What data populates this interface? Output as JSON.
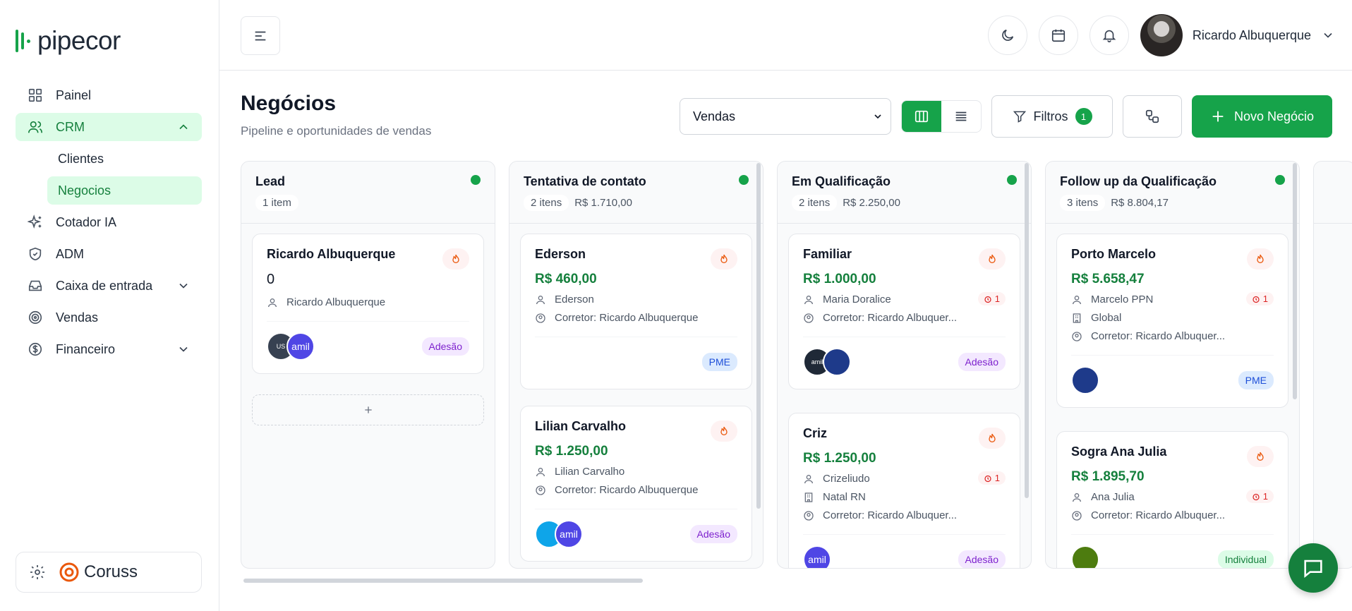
{
  "brand": {
    "name": "pipecor",
    "footer_brand": "Coruss"
  },
  "colors": {
    "accent": "#16a34a",
    "accent_light": "#dcfce7",
    "adesao": "#7e22ce",
    "pme": "#1d4ed8",
    "alert": "#dc2626"
  },
  "sidebar": {
    "items": [
      {
        "label": "Painel",
        "icon": "grid-icon"
      },
      {
        "label": "CRM",
        "icon": "users-icon"
      },
      {
        "label": "Clientes"
      },
      {
        "label": "Negocios"
      },
      {
        "label": "Cotador IA",
        "icon": "sparkles-icon"
      },
      {
        "label": "ADM",
        "icon": "shield-icon"
      },
      {
        "label": "Caixa de entrada",
        "icon": "inbox-icon"
      },
      {
        "label": "Vendas",
        "icon": "target-icon"
      },
      {
        "label": "Financeiro",
        "icon": "dollar-circle-icon"
      }
    ]
  },
  "header": {
    "user_name": "Ricardo Albuquerque"
  },
  "page": {
    "title": "Negócios",
    "subtitle": "Pipeline e oportunidades de vendas"
  },
  "toolbar": {
    "pipeline_select": "Vendas",
    "filters_label": "Filtros",
    "filters_count": "1",
    "new_label": "Novo Negócio"
  },
  "columns": [
    {
      "title": "Lead",
      "count": "1 item",
      "total": "",
      "cards": [
        {
          "title": "Ricardo Albuquerque",
          "amount": "0",
          "contact": "Ricardo Albuquerque",
          "tag": "Adesão"
        }
      ]
    },
    {
      "title": "Tentativa de contato",
      "count": "2 itens",
      "total": "R$ 1.710,00",
      "cards": [
        {
          "title": "Ederson",
          "amount": "R$ 460,00",
          "contact": "Ederson",
          "broker": "Corretor: Ricardo Albuquerque",
          "tag": "PME"
        },
        {
          "title": "Lilian Carvalho",
          "amount": "R$ 1.250,00",
          "contact": "Lilian Carvalho",
          "broker": "Corretor: Ricardo Albuquerque",
          "tag": "Adesão"
        }
      ]
    },
    {
      "title": "Em Qualificação",
      "count": "2 itens",
      "total": "R$ 2.250,00",
      "cards": [
        {
          "title": "Familiar",
          "amount": "R$ 1.000,00",
          "contact": "Maria Doralice",
          "broker": "Corretor: Ricardo Albuquer...",
          "alerts": "1",
          "tag": "Adesão"
        },
        {
          "title": "Criz",
          "amount": "R$ 1.250,00",
          "contact": "Crizeliudo",
          "company": "Natal RN",
          "broker": "Corretor: Ricardo Albuquer...",
          "alerts": "1",
          "tag": "Adesão"
        }
      ]
    },
    {
      "title": "Follow up da Qualificação",
      "count": "3 itens",
      "total": "R$ 8.804,17",
      "cards": [
        {
          "title": "Porto Marcelo",
          "amount": "R$ 5.658,47",
          "contact": "Marcelo PPN",
          "company": "Global",
          "broker": "Corretor: Ricardo Albuquer...",
          "alerts": "1",
          "tag": "PME"
        },
        {
          "title": "Sogra Ana Julia",
          "amount": "R$ 1.895,70",
          "contact": "Ana Julia",
          "broker": "Corretor: Ricardo Albuquer...",
          "alerts": "1",
          "tag": "Individual"
        }
      ]
    }
  ],
  "logo_texts": {
    "amil": "amil",
    "us": "US",
    "affix": "affix"
  }
}
